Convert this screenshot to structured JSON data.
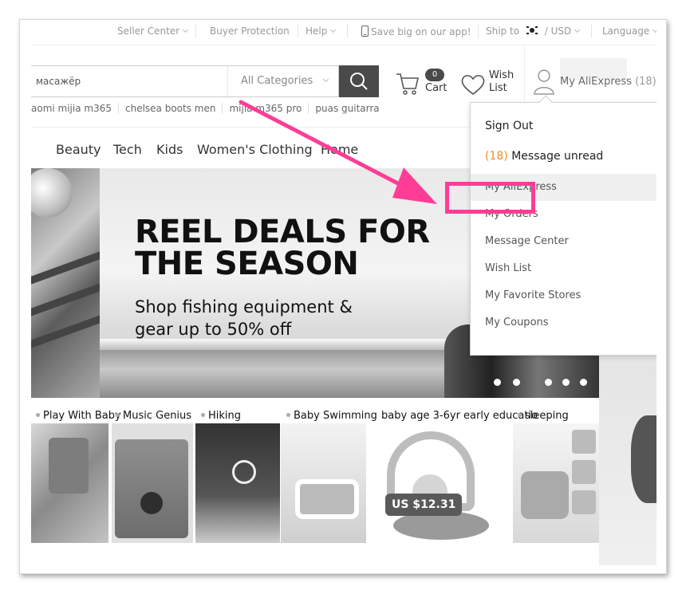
{
  "topbar": {
    "seller_center": "Seller Center",
    "buyer_protection": "Buyer Protection",
    "help": "Help",
    "app_promo": "Save big on our app!",
    "ship_to_label": "Ship to",
    "currency": "USD",
    "language": "Language"
  },
  "search": {
    "value": "масажёр",
    "category": "All Categories"
  },
  "cart": {
    "count": "0",
    "label": "Cart"
  },
  "wishlist": {
    "line1": "Wish",
    "line2": "List"
  },
  "account": {
    "label": "My AliExpress",
    "count": "(18)"
  },
  "hot_searches": [
    "aomi mijia m365",
    "chelsea boots men",
    "mijia m365 pro",
    "puas guitarra"
  ],
  "nav": [
    "Beauty",
    "Tech",
    "Kids",
    "Women's Clothing",
    "Home"
  ],
  "banner": {
    "title_line1": "REEL DEALS FOR",
    "title_line2": "THE SEASON",
    "subtitle_line1": "Shop fishing equipment &",
    "subtitle_line2": "gear up to 50% off"
  },
  "categories": [
    "Play With Baby",
    "Music Genius",
    "Hiking",
    "Baby Swimming",
    "baby age 3-6yr early educatio",
    "sleeping"
  ],
  "product_price": "US $12.31",
  "dropdown": {
    "sign_out": "Sign Out",
    "unread_count": "(18)",
    "unread_label": "Message unread",
    "items": [
      "My AliExpress",
      "My Orders",
      "Message Center",
      "Wish List",
      "My Favorite Stores",
      "My Coupons"
    ]
  },
  "colors": {
    "annotation": "#ff3d96",
    "unread": "#f08a24",
    "search_button": "#4a4a4a"
  }
}
